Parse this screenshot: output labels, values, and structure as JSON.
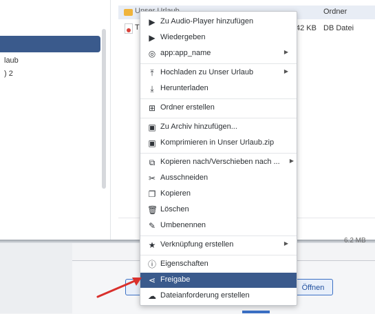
{
  "sidebar": {
    "item1": "laub",
    "item2": ") 2"
  },
  "files": [
    {
      "name": "Unser Urlaub",
      "size": "",
      "type": "Ordner",
      "icon": "folder-icon"
    },
    {
      "name": "T",
      "size": "42 KB",
      "type": "DB Datei",
      "icon": "pdf-file-icon"
    }
  ],
  "status": {
    "size_partial": "6.2 MB"
  },
  "dialog": {
    "open_button": "Öffnen"
  },
  "menu": {
    "items": [
      {
        "label": "Zu Audio-Player hinzufügen",
        "icon": "play-icon"
      },
      {
        "label": "Wiedergeben",
        "icon": "play-icon"
      },
      {
        "label": "app:app_name",
        "icon": "app-icon",
        "submenu": true
      },
      {
        "label": "Hochladen zu Unser Urlaub",
        "icon": "upload-icon",
        "submenu": true
      },
      {
        "label": "Herunterladen",
        "icon": "download-icon"
      },
      {
        "label": "Ordner erstellen",
        "icon": "create-folder-icon"
      },
      {
        "label": "Zu Archiv hinzufügen...",
        "icon": "archive-icon"
      },
      {
        "label": "Komprimieren in Unser Urlaub.zip",
        "icon": "compress-icon"
      },
      {
        "label": "Kopieren nach/Verschieben nach ...",
        "icon": "copy-move-icon",
        "submenu": true
      },
      {
        "label": "Ausschneiden",
        "icon": "scissors-icon"
      },
      {
        "label": "Kopieren",
        "icon": "copy-icon"
      },
      {
        "label": "Löschen",
        "icon": "trash-icon"
      },
      {
        "label": "Umbenennen",
        "icon": "pencil-icon"
      },
      {
        "label": "Verknüpfung erstellen",
        "icon": "star-icon",
        "submenu": true
      },
      {
        "label": "Eigenschaften",
        "icon": "info-icon"
      },
      {
        "label": "Freigabe",
        "icon": "share-icon",
        "selected": true
      },
      {
        "label": "Dateianforderung erstellen",
        "icon": "cloud-upload-icon"
      }
    ]
  },
  "colors": {
    "accent": "#3a5a8c",
    "arrow": "#d9302c",
    "folder": "#f0b43c"
  }
}
